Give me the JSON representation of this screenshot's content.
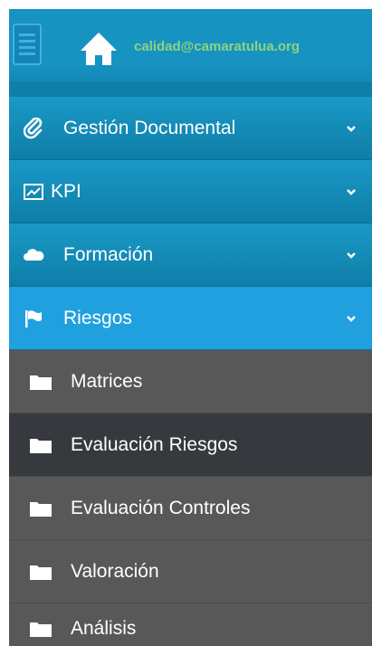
{
  "header": {
    "email": "calidad@camaratulua.org"
  },
  "menu": [
    {
      "label": "Gestión Documental",
      "icon": "paperclip-icon"
    },
    {
      "label": "KPI",
      "icon": "chart-icon"
    },
    {
      "label": "Formación",
      "icon": "cloud-icon"
    },
    {
      "label": "Riesgos",
      "icon": "flag-icon",
      "active": true
    }
  ],
  "submenu": [
    {
      "label": "Matrices",
      "icon": "folder-icon"
    },
    {
      "label": "Evaluación Riesgos",
      "icon": "folder-icon"
    },
    {
      "label": "Evaluación Controles",
      "icon": "folder-icon"
    },
    {
      "label": "Valoración",
      "icon": "folder-icon"
    },
    {
      "label": "Análisis",
      "icon": "folder-icon"
    }
  ],
  "colors": {
    "header_blue": "#1793c2",
    "active_blue": "#21a0e0",
    "submenu_gray": "#585858",
    "submenu_hover": "#36393e",
    "email_green": "#8fd37e"
  }
}
